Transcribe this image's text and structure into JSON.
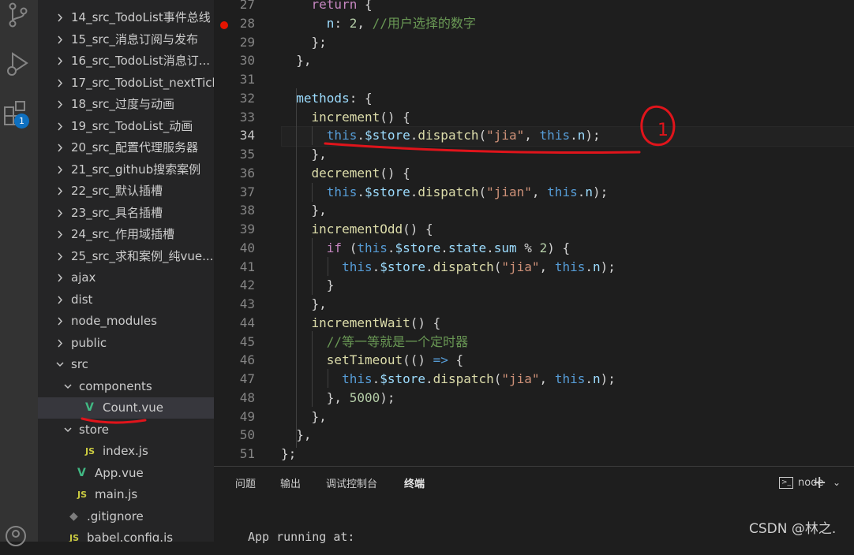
{
  "sidebar": {
    "items": [
      {
        "label": "14_src_TodoList事件总线",
        "type": "folder",
        "expanded": false,
        "depth": 1
      },
      {
        "label": "15_src_消息订阅与发布",
        "type": "folder",
        "expanded": false,
        "depth": 1
      },
      {
        "label": "16_src_TodoList消息订...",
        "type": "folder",
        "expanded": false,
        "depth": 1
      },
      {
        "label": "17_src_TodoList_nextTick",
        "type": "folder",
        "expanded": false,
        "depth": 1
      },
      {
        "label": "18_src_过度与动画",
        "type": "folder",
        "expanded": false,
        "depth": 1
      },
      {
        "label": "19_src_TodoList_动画",
        "type": "folder",
        "expanded": false,
        "depth": 1
      },
      {
        "label": "20_src_配置代理服务器",
        "type": "folder",
        "expanded": false,
        "depth": 1
      },
      {
        "label": "21_src_github搜索案例",
        "type": "folder",
        "expanded": false,
        "depth": 1
      },
      {
        "label": "22_src_默认插槽",
        "type": "folder",
        "expanded": false,
        "depth": 1
      },
      {
        "label": "23_src_具名插槽",
        "type": "folder",
        "expanded": false,
        "depth": 1
      },
      {
        "label": "24_src_作用域插槽",
        "type": "folder",
        "expanded": false,
        "depth": 1
      },
      {
        "label": "25_src_求和案例_纯vue...",
        "type": "folder",
        "expanded": false,
        "depth": 1
      },
      {
        "label": "ajax",
        "type": "folder",
        "expanded": false,
        "depth": 1
      },
      {
        "label": "dist",
        "type": "folder",
        "expanded": false,
        "depth": 1
      },
      {
        "label": "node_modules",
        "type": "folder",
        "expanded": false,
        "depth": 1
      },
      {
        "label": "public",
        "type": "folder",
        "expanded": false,
        "depth": 1
      },
      {
        "label": "src",
        "type": "folder",
        "expanded": true,
        "depth": 1
      },
      {
        "label": "components",
        "type": "folder",
        "expanded": true,
        "depth": 2
      },
      {
        "label": "Count.vue",
        "type": "vue",
        "depth": 3,
        "selected": true
      },
      {
        "label": "store",
        "type": "folder",
        "expanded": true,
        "depth": 2
      },
      {
        "label": "index.js",
        "type": "js",
        "depth": 3
      },
      {
        "label": "App.vue",
        "type": "vue",
        "depth": 2
      },
      {
        "label": "main.js",
        "type": "js",
        "depth": 2
      },
      {
        "label": ".gitignore",
        "type": "git",
        "depth": 1
      },
      {
        "label": "babel.config.js",
        "type": "js",
        "depth": 1
      }
    ],
    "js_icon": "JS",
    "vue_icon": "V",
    "git_icon": "◆",
    "badge": "1"
  },
  "editor": {
    "current_line": "34",
    "breakpoint_line": "28",
    "lines": [
      {
        "no": "27",
        "t": [
          [
            "    ",
            "p"
          ],
          [
            "return",
            "k"
          ],
          [
            " {",
            "p"
          ]
        ]
      },
      {
        "no": "28",
        "t": [
          [
            "      ",
            "p"
          ],
          [
            "n",
            "v"
          ],
          [
            ": ",
            "p"
          ],
          [
            "2",
            "n"
          ],
          [
            ", ",
            "p"
          ],
          [
            "//用户选择的数字",
            "c"
          ]
        ]
      },
      {
        "no": "29",
        "t": [
          [
            "    };",
            "p"
          ]
        ]
      },
      {
        "no": "30",
        "t": [
          [
            "  },",
            "p"
          ]
        ]
      },
      {
        "no": "31",
        "t": [
          [
            "",
            "p"
          ]
        ]
      },
      {
        "no": "32",
        "t": [
          [
            "  ",
            "p"
          ],
          [
            "methods",
            "v"
          ],
          [
            ": {",
            "p"
          ]
        ]
      },
      {
        "no": "33",
        "t": [
          [
            "    ",
            "p"
          ],
          [
            "increment",
            "f"
          ],
          [
            "() {",
            "p"
          ]
        ]
      },
      {
        "no": "34",
        "t": [
          [
            "      ",
            "p"
          ],
          [
            "this",
            "b"
          ],
          [
            ".",
            "p"
          ],
          [
            "$store",
            "v"
          ],
          [
            ".",
            "p"
          ],
          [
            "dispatch",
            "f"
          ],
          [
            "(",
            "p"
          ],
          [
            "\"jia\"",
            "s"
          ],
          [
            ", ",
            "p"
          ],
          [
            "this",
            "b"
          ],
          [
            ".",
            "p"
          ],
          [
            "n",
            "v"
          ],
          [
            ");",
            "p"
          ]
        ]
      },
      {
        "no": "35",
        "t": [
          [
            "    },",
            "p"
          ]
        ]
      },
      {
        "no": "36",
        "t": [
          [
            "    ",
            "p"
          ],
          [
            "decrement",
            "f"
          ],
          [
            "() {",
            "p"
          ]
        ]
      },
      {
        "no": "37",
        "t": [
          [
            "      ",
            "p"
          ],
          [
            "this",
            "b"
          ],
          [
            ".",
            "p"
          ],
          [
            "$store",
            "v"
          ],
          [
            ".",
            "p"
          ],
          [
            "dispatch",
            "f"
          ],
          [
            "(",
            "p"
          ],
          [
            "\"jian\"",
            "s"
          ],
          [
            ", ",
            "p"
          ],
          [
            "this",
            "b"
          ],
          [
            ".",
            "p"
          ],
          [
            "n",
            "v"
          ],
          [
            ");",
            "p"
          ]
        ]
      },
      {
        "no": "38",
        "t": [
          [
            "    },",
            "p"
          ]
        ]
      },
      {
        "no": "39",
        "t": [
          [
            "    ",
            "p"
          ],
          [
            "incrementOdd",
            "f"
          ],
          [
            "() {",
            "p"
          ]
        ]
      },
      {
        "no": "40",
        "t": [
          [
            "      ",
            "p"
          ],
          [
            "if",
            "k"
          ],
          [
            " (",
            "p"
          ],
          [
            "this",
            "b"
          ],
          [
            ".",
            "p"
          ],
          [
            "$store",
            "v"
          ],
          [
            ".",
            "p"
          ],
          [
            "state",
            "v"
          ],
          [
            ".",
            "p"
          ],
          [
            "sum",
            "v"
          ],
          [
            " % ",
            "p"
          ],
          [
            "2",
            "n"
          ],
          [
            ") {",
            "p"
          ]
        ]
      },
      {
        "no": "41",
        "t": [
          [
            "        ",
            "p"
          ],
          [
            "this",
            "b"
          ],
          [
            ".",
            "p"
          ],
          [
            "$store",
            "v"
          ],
          [
            ".",
            "p"
          ],
          [
            "dispatch",
            "f"
          ],
          [
            "(",
            "p"
          ],
          [
            "\"jia\"",
            "s"
          ],
          [
            ", ",
            "p"
          ],
          [
            "this",
            "b"
          ],
          [
            ".",
            "p"
          ],
          [
            "n",
            "v"
          ],
          [
            ");",
            "p"
          ]
        ]
      },
      {
        "no": "42",
        "t": [
          [
            "      }",
            "p"
          ]
        ]
      },
      {
        "no": "43",
        "t": [
          [
            "    },",
            "p"
          ]
        ]
      },
      {
        "no": "44",
        "t": [
          [
            "    ",
            "p"
          ],
          [
            "incrementWait",
            "f"
          ],
          [
            "() {",
            "p"
          ]
        ]
      },
      {
        "no": "45",
        "t": [
          [
            "      ",
            "p"
          ],
          [
            "//等一等就是一个定时器",
            "c"
          ]
        ]
      },
      {
        "no": "46",
        "t": [
          [
            "      ",
            "p"
          ],
          [
            "setTimeout",
            "f"
          ],
          [
            "(() ",
            "p"
          ],
          [
            "=>",
            "b"
          ],
          [
            " {",
            "p"
          ]
        ]
      },
      {
        "no": "47",
        "t": [
          [
            "        ",
            "p"
          ],
          [
            "this",
            "b"
          ],
          [
            ".",
            "p"
          ],
          [
            "$store",
            "v"
          ],
          [
            ".",
            "p"
          ],
          [
            "dispatch",
            "f"
          ],
          [
            "(",
            "p"
          ],
          [
            "\"jia\"",
            "s"
          ],
          [
            ", ",
            "p"
          ],
          [
            "this",
            "b"
          ],
          [
            ".",
            "p"
          ],
          [
            "n",
            "v"
          ],
          [
            ");",
            "p"
          ]
        ]
      },
      {
        "no": "48",
        "t": [
          [
            "      }, ",
            "p"
          ],
          [
            "5000",
            "n"
          ],
          [
            ");",
            "p"
          ]
        ]
      },
      {
        "no": "49",
        "t": [
          [
            "    },",
            "p"
          ]
        ]
      },
      {
        "no": "50",
        "t": [
          [
            "  },",
            "p"
          ]
        ]
      },
      {
        "no": "51",
        "t": [
          [
            "};",
            "p"
          ]
        ]
      }
    ]
  },
  "panel": {
    "tabs": [
      {
        "label": "问题",
        "active": false
      },
      {
        "label": "输出",
        "active": false
      },
      {
        "label": "调试控制台",
        "active": false
      },
      {
        "label": "终端",
        "active": true
      }
    ],
    "terminal_name": "node",
    "terminal_output": "App running at:"
  },
  "annotation": {
    "label": "1"
  },
  "watermark": "CSDN @林之."
}
